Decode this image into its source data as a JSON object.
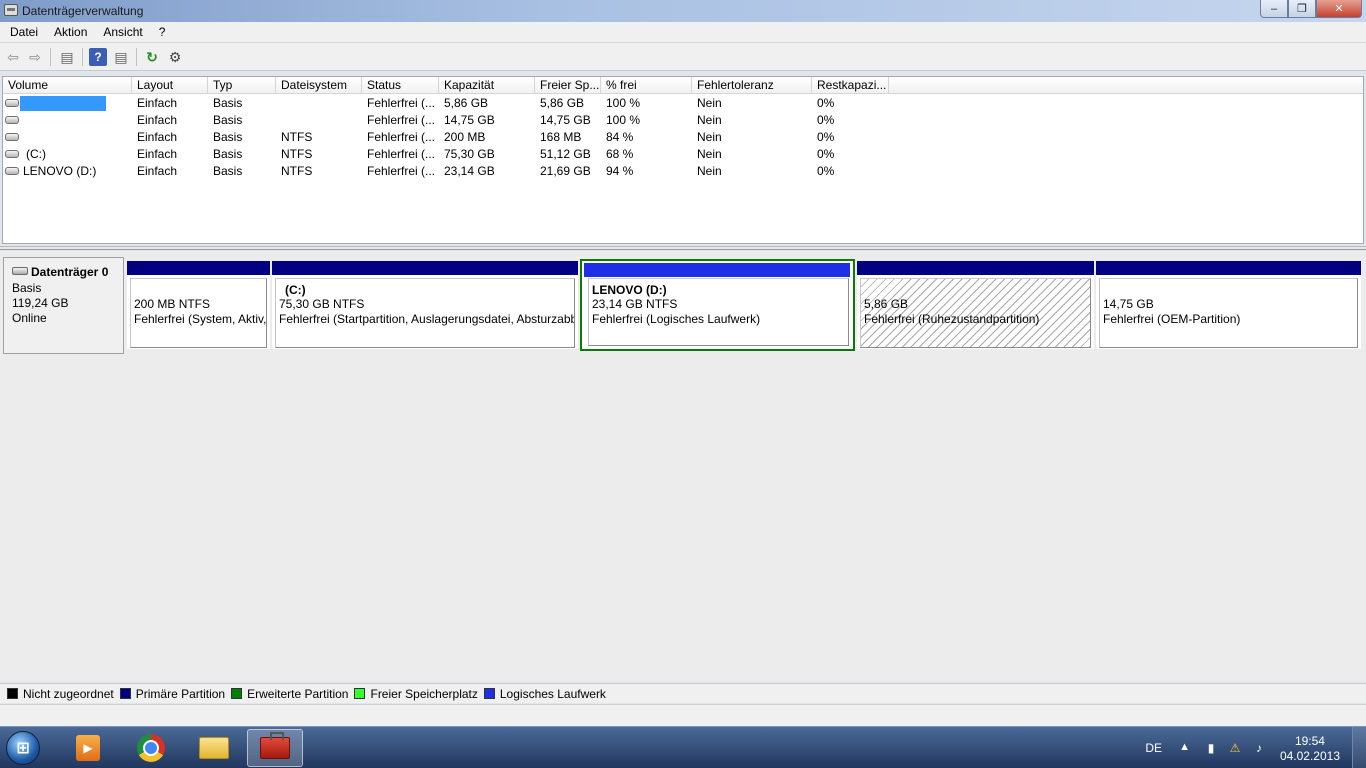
{
  "window": {
    "title": "Datenträgerverwaltung"
  },
  "window_buttons": [
    "–",
    "❐",
    "✕"
  ],
  "menu": [
    "Datei",
    "Aktion",
    "Ansicht",
    "?"
  ],
  "toolbar": [
    {
      "icon": "back-arrow-icon",
      "glyph": "⇦"
    },
    {
      "icon": "forward-arrow-icon",
      "glyph": "⇨"
    },
    {
      "icon": "console-tree-icon",
      "glyph": "▤"
    },
    {
      "icon": "help-icon",
      "glyph": "?"
    },
    {
      "icon": "properties-icon",
      "glyph": "▤"
    },
    {
      "icon": "refresh-icon",
      "glyph": "↻"
    },
    {
      "icon": "rescan-disks-icon",
      "glyph": "⚙"
    }
  ],
  "volume_table": {
    "columns": [
      "Volume",
      "Layout",
      "Typ",
      "Dateisystem",
      "Status",
      "Kapazität",
      "Freier Sp...",
      "% frei",
      "Fehlertoleranz",
      "Restkapazi..."
    ],
    "rows": [
      [
        "",
        "Einfach",
        "Basis",
        "",
        "Fehlerfrei (...",
        "5,86 GB",
        "5,86 GB",
        "100 %",
        "Nein",
        "0%"
      ],
      [
        "",
        "Einfach",
        "Basis",
        "",
        "Fehlerfrei (...",
        "14,75 GB",
        "14,75 GB",
        "100 %",
        "Nein",
        "0%"
      ],
      [
        "",
        "Einfach",
        "Basis",
        "NTFS",
        "Fehlerfrei (...",
        "200 MB",
        "168 MB",
        "84 %",
        "Nein",
        "0%"
      ],
      [
        "(C:)",
        "Einfach",
        "Basis",
        "NTFS",
        "Fehlerfrei (...",
        "75,30 GB",
        "51,12 GB",
        "68 %",
        "Nein",
        "0%"
      ],
      [
        "LENOVO (D:)",
        "Einfach",
        "Basis",
        "NTFS",
        "Fehlerfrei (...",
        "23,14 GB",
        "21,69 GB",
        "94 %",
        "Nein",
        "0%"
      ]
    ]
  },
  "disk": {
    "name": "Datenträger 0",
    "type": "Basis",
    "size": "119,24 GB",
    "status": "Online"
  },
  "partitions": [
    {
      "name": "",
      "size": "200 MB NTFS",
      "status": "Fehlerfrei (System, Aktiv,"
    },
    {
      "name": "(C:)",
      "size": "75,30 GB NTFS",
      "status": "Fehlerfrei (Startpartition, Auslagerungsdatei, Absturzabb"
    },
    {
      "name": "LENOVO  (D:)",
      "size": "23,14 GB NTFS",
      "status": "Fehlerfrei (Logisches Laufwerk)"
    },
    {
      "name": "",
      "size": "5,86 GB",
      "status": "Fehlerfrei (Ruhezustandpartition)"
    },
    {
      "name": "",
      "size": "14,75 GB",
      "status": "Fehlerfrei (OEM-Partition)"
    }
  ],
  "legend": [
    {
      "label": "Nicht zugeordnet",
      "color": "#000000"
    },
    {
      "label": "Primäre Partition",
      "color": "#000080"
    },
    {
      "label": "Erweiterte Partition",
      "color": "#008000"
    },
    {
      "label": "Freier Speicherplatz",
      "color": "#33ff33"
    },
    {
      "label": "Logisches Laufwerk",
      "color": "#1f2fe6"
    }
  ],
  "taskbar": {
    "start_glyph": "⊞",
    "media_glyph": "▶",
    "language": "DE",
    "tray_arrow": "▲",
    "tray_icons": [
      "▮",
      "⚠",
      "♪"
    ],
    "time": "19:54",
    "date": "04.02.2013"
  }
}
